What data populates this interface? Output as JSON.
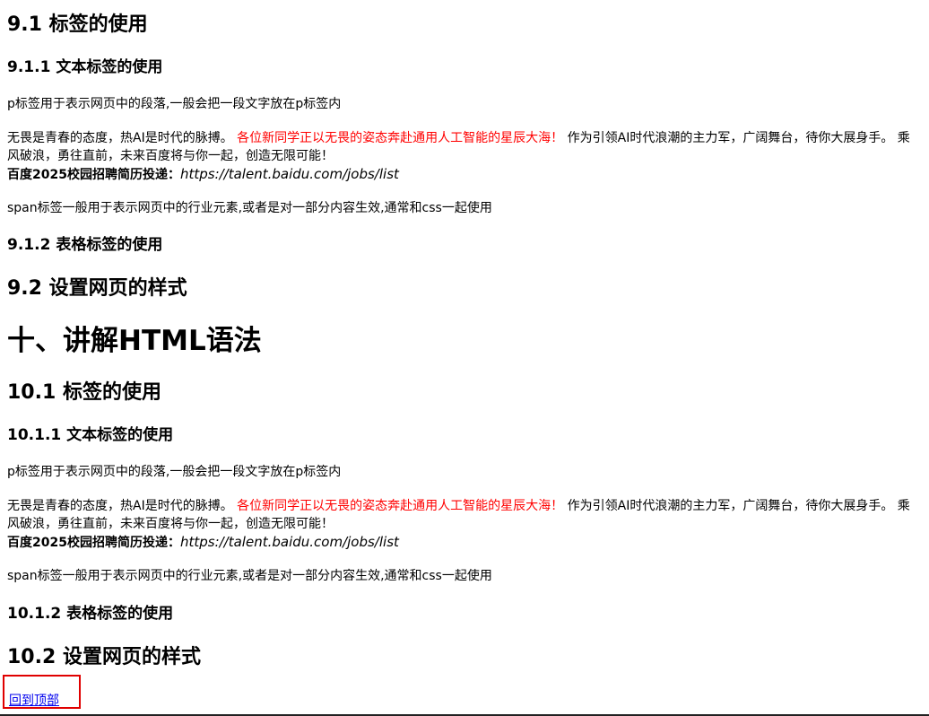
{
  "s9": {
    "h_9_1": "9.1 标签的使用",
    "h_9_1_1": "9.1.1 文本标签的使用",
    "p_tag": "p标签用于表示网页中的段落,一般会把一段文字放在p标签内",
    "intro_a": "无畏是青春的态度，热AI是时代的脉搏。",
    "intro_red": "各位新同学正以无畏的姿态奔赴通用人工智能的星辰大海！",
    "intro_b": "作为引领AI时代浪潮的主力军，广阔舞台，待你大展身手。 乘风破浪，勇往直前，未来百度将与你一起，创造无限可能！",
    "lead_label": "百度2025校园招聘简历投递：",
    "lead_url": "https://talent.baidu.com/jobs/list",
    "span_tag": "span标签一般用于表示网页中的行业元素,或者是对一部分内容生效,通常和css一起使用",
    "h_9_1_2": "9.1.2 表格标签的使用",
    "h_9_2": "9.2 设置网页的样式"
  },
  "s10": {
    "h_10": "十、讲解HTML语法",
    "h_10_1": "10.1 标签的使用",
    "h_10_1_1": "10.1.1 文本标签的使用",
    "p_tag": "p标签用于表示网页中的段落,一般会把一段文字放在p标签内",
    "intro_a": "无畏是青春的态度，热AI是时代的脉搏。",
    "intro_red": "各位新同学正以无畏的姿态奔赴通用人工智能的星辰大海！",
    "intro_b": "作为引领AI时代浪潮的主力军，广阔舞台，待你大展身手。 乘风破浪，勇往直前，未来百度将与你一起，创造无限可能！",
    "lead_label": "百度2025校园招聘简历投递：",
    "lead_url": "https://talent.baidu.com/jobs/list",
    "span_tag": "span标签一般用于表示网页中的行业元素,或者是对一部分内容生效,通常和css一起使用",
    "h_10_1_2": "10.1.2 表格标签的使用",
    "h_10_2": "10.2 设置网页的样式"
  },
  "back_to_top": "回到顶部",
  "colors": {
    "highlight": "#ff0000",
    "link": "#0000ee",
    "focus_box": "#e00000"
  }
}
